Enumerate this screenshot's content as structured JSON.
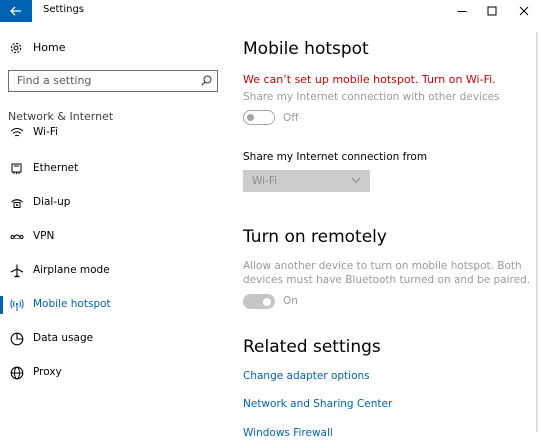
{
  "window": {
    "title": "Settings",
    "back_icon": "back-arrow-icon",
    "minimize_icon": "minimize-icon",
    "maximize_icon": "maximize-icon",
    "close_icon": "close-icon",
    "accent": "#0063b1"
  },
  "sidebar": {
    "home_label": "Home",
    "search_placeholder": "Find a setting",
    "section_label": "Network & Internet",
    "items": [
      {
        "label": "Wi-Fi",
        "icon": "wifi-icon",
        "active": false
      },
      {
        "label": "Ethernet",
        "icon": "ethernet-icon",
        "active": false
      },
      {
        "label": "Dial-up",
        "icon": "dialup-icon",
        "active": false
      },
      {
        "label": "VPN",
        "icon": "vpn-icon",
        "active": false
      },
      {
        "label": "Airplane mode",
        "icon": "airplane-icon",
        "active": false
      },
      {
        "label": "Mobile hotspot",
        "icon": "hotspot-icon",
        "active": true
      },
      {
        "label": "Data usage",
        "icon": "data-usage-icon",
        "active": false
      },
      {
        "label": "Proxy",
        "icon": "globe-icon",
        "active": false
      }
    ]
  },
  "main": {
    "hotspot_title": "Mobile hotspot",
    "error_text": "We can’t set up mobile hotspot. Turn on Wi-Fi.",
    "share_label": "Share my Internet connection with other devices",
    "share_toggle_state": "Off",
    "share_from_label": "Share my Internet connection from",
    "share_from_value": "Wi-Fi",
    "remote_title": "Turn on remotely",
    "remote_desc_line1": "Allow another device to turn on mobile hotspot. Both",
    "remote_desc_line2": "devices must have Bluetooth turned on and be paired.",
    "remote_toggle_state": "On",
    "related_title": "Related settings",
    "links": [
      "Change adapter options",
      "Network and Sharing Center",
      "Windows Firewall"
    ],
    "error_color": "#c50500",
    "link_color": "#0063b1"
  }
}
